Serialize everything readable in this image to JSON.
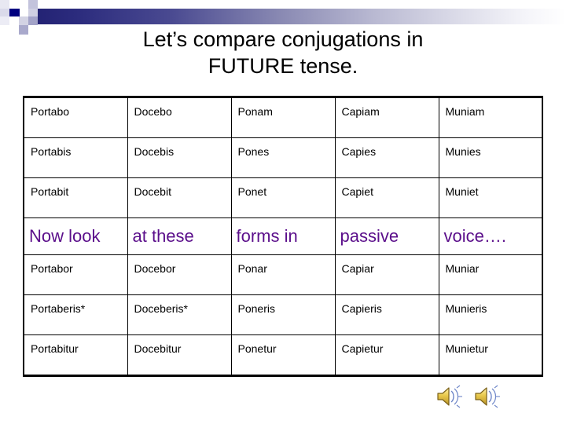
{
  "slide": {
    "title": "Let’s compare conjugations in\nFUTURE tense.",
    "background_color": "#ffffff",
    "accent_color": "#232273",
    "note_text_color": "#5B0F8B"
  },
  "header": {
    "decoration_name": "pixel-squares-and-gradient-bar",
    "gradient_start": "#232273",
    "gradient_end": "#ffffff"
  },
  "table": {
    "rows": [
      {
        "kind": "conjugation",
        "cells": [
          "Portabo",
          "Docebo",
          "Ponam",
          "Capiam",
          "Muniam"
        ]
      },
      {
        "kind": "conjugation",
        "cells": [
          "Portabis",
          "Docebis",
          "Pones",
          "Capies",
          "Munies"
        ]
      },
      {
        "kind": "conjugation",
        "cells": [
          "Portabit",
          "Docebit",
          "Ponet",
          "Capiet",
          "Muniet"
        ]
      },
      {
        "kind": "note",
        "cells": [
          "Now look",
          "at  these",
          "forms in",
          "passive",
          "voice…."
        ]
      },
      {
        "kind": "conjugation",
        "cells": [
          "Portabor",
          "Docebor",
          "Ponar",
          "Capiar",
          "Muniar"
        ]
      },
      {
        "kind": "conjugation",
        "cells": [
          "Portaberis*",
          "Doceberis*",
          "Poneris",
          "Capieris",
          "Munieris"
        ]
      },
      {
        "kind": "conjugation",
        "cells": [
          "Portabitur",
          "Docebitur",
          "Ponetur",
          "Capietur",
          "Munietur"
        ]
      }
    ]
  },
  "media": {
    "sound_icons": [
      {
        "name": "sound-icon-1",
        "label": "Play audio 1"
      },
      {
        "name": "sound-icon-2",
        "label": "Play audio 2"
      }
    ]
  }
}
